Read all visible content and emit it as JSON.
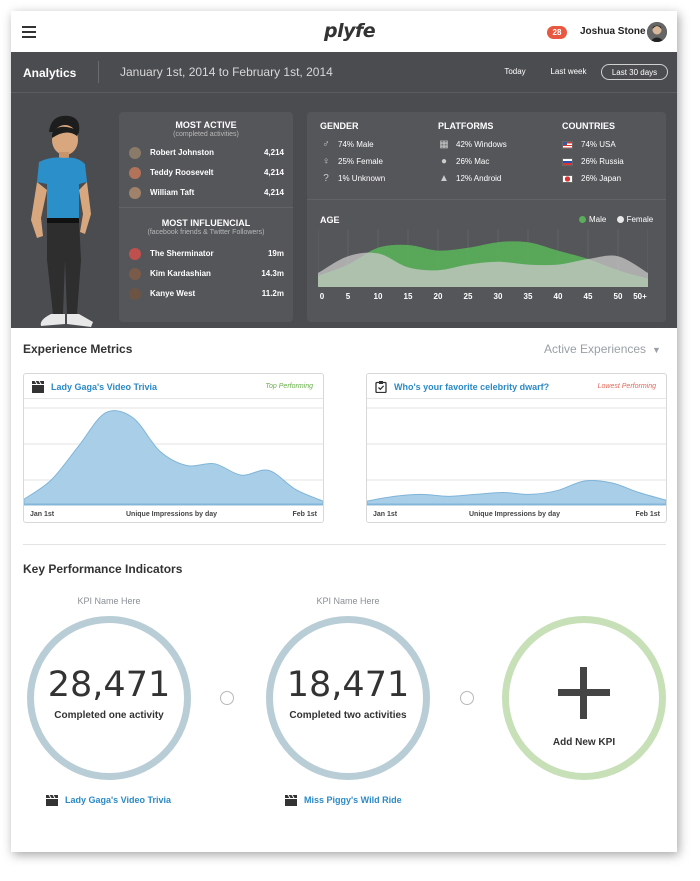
{
  "topbar": {
    "logo": "plyfe",
    "notification_count": "28",
    "user_name": "Joshua Stone"
  },
  "analytics": {
    "title": "Analytics",
    "date_range": "January 1st, 2014 to February 1st, 2014",
    "ranges": [
      "Today",
      "Last week",
      "Last 30 days"
    ],
    "active_range": "Last 30 days"
  },
  "most_active": {
    "title": "MOST ACTIVE",
    "subtitle": "(completed activities)",
    "people": [
      {
        "name": "Robert Johnston",
        "value": "4,214"
      },
      {
        "name": "Teddy Roosevelt",
        "value": "4,214"
      },
      {
        "name": "William Taft",
        "value": "4,214"
      }
    ]
  },
  "most_influential": {
    "title": "MOST INFLUENCIAL",
    "subtitle": "(facebook friends & Twitter Followers)",
    "people": [
      {
        "name": "The Sherminator",
        "value": "19m"
      },
      {
        "name": "Kim Kardashian",
        "value": "14.3m"
      },
      {
        "name": "Kanye West",
        "value": "11.2m"
      }
    ]
  },
  "demographics": {
    "gender": {
      "title": "GENDER",
      "items": [
        {
          "icon": "male-icon",
          "label": "74% Male"
        },
        {
          "icon": "female-icon",
          "label": "25% Female"
        },
        {
          "icon": "unknown-icon",
          "label": "1% Unknown"
        }
      ]
    },
    "platforms": {
      "title": "PLATFORMS",
      "items": [
        {
          "icon": "windows-icon",
          "label": "42% Windows"
        },
        {
          "icon": "apple-icon",
          "label": "26% Mac"
        },
        {
          "icon": "android-icon",
          "label": "12% Android"
        }
      ]
    },
    "countries": {
      "title": "COUNTRIES",
      "items": [
        {
          "icon": "usa-flag-icon",
          "label": "74% USA"
        },
        {
          "icon": "russia-flag-icon",
          "label": "26% Russia"
        },
        {
          "icon": "japan-flag-icon",
          "label": "26% Japan"
        }
      ]
    }
  },
  "age_chart": {
    "title": "AGE",
    "legend": [
      "Male",
      "Female"
    ],
    "colors": {
      "male": "#5aad5a",
      "female": "#c9c9c9"
    },
    "x_labels": [
      "0",
      "5",
      "10",
      "15",
      "20",
      "25",
      "30",
      "35",
      "40",
      "45",
      "50",
      "50+"
    ],
    "male": [
      20,
      40,
      70,
      75,
      65,
      70,
      80,
      80,
      65,
      50,
      30,
      15
    ],
    "female": [
      25,
      55,
      60,
      35,
      30,
      40,
      45,
      40,
      40,
      50,
      55,
      25
    ]
  },
  "experience": {
    "title": "Experience Metrics",
    "selector": "Active Experiences",
    "cards": [
      {
        "title": "Lady Gaga's Video Trivia",
        "badge": "Top Performing",
        "badge_color": "#6ab04c",
        "x_start": "Jan 1st",
        "x_label": "Unique Impressions by day",
        "x_end": "Feb 1st",
        "values": [
          5,
          25,
          60,
          95,
          90,
          55,
          40,
          42,
          30,
          35,
          15,
          3
        ]
      },
      {
        "title": "Who's your favorite celebrity dwarf?",
        "badge": "Lowest Performing",
        "badge_color": "#e06a5a",
        "x_start": "Jan 1st",
        "x_label": "Unique Impressions by day",
        "x_end": "Feb 1st",
        "values": [
          3,
          8,
          10,
          8,
          10,
          12,
          10,
          14,
          24,
          22,
          12,
          4
        ]
      }
    ]
  },
  "kpi": {
    "title": "Key Performance Indicators",
    "items": [
      {
        "name": "KPI Name Here",
        "value": "28,471",
        "caption": "Completed one activity",
        "link": "Lady Gaga's Video Trivia"
      },
      {
        "name": "KPI Name Here",
        "value": "18,471",
        "caption": "Completed two activities",
        "link": "Miss Piggy's Wild Ride"
      }
    ],
    "add_label": "Add New KPI"
  }
}
